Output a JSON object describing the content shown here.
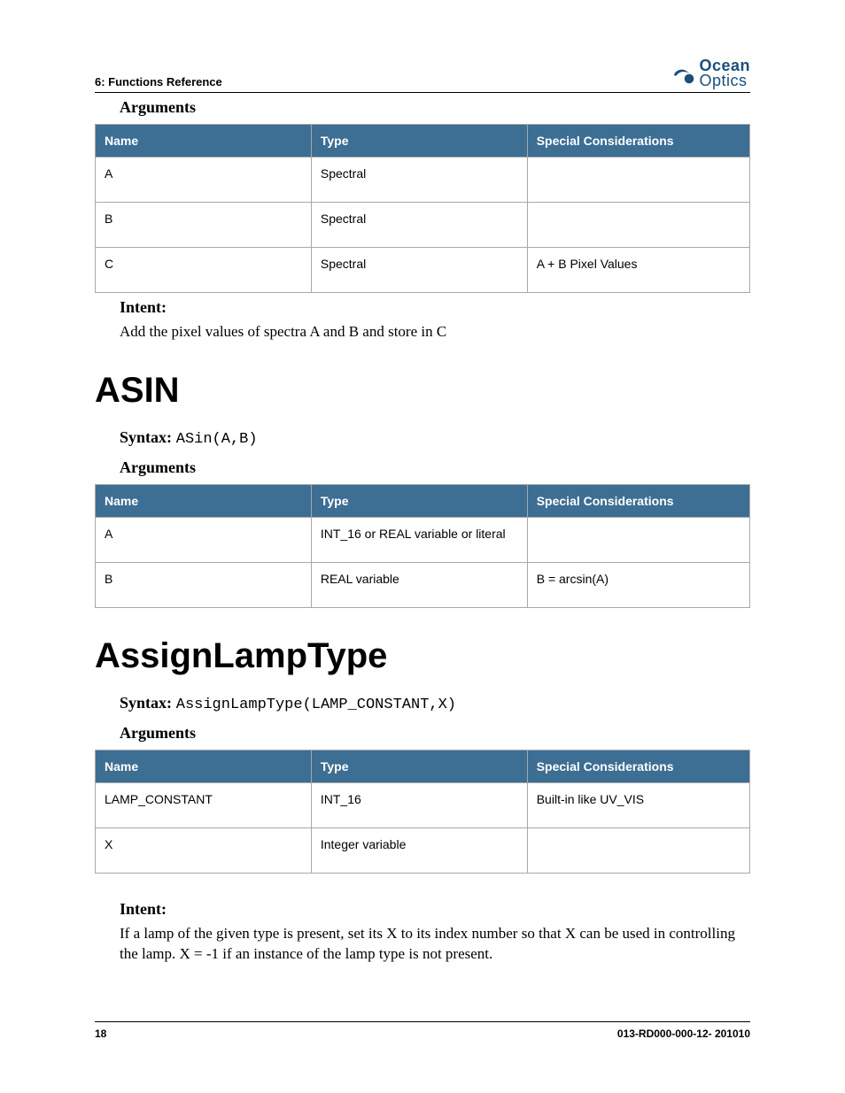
{
  "header": {
    "chapter": "6: Functions Reference",
    "logo_top": "Ocean",
    "logo_bottom": "Optics"
  },
  "labels": {
    "arguments": "Arguments",
    "intent": "Intent:",
    "syntax": "Syntax:",
    "col_name": "Name",
    "col_type": "Type",
    "col_spec": "Special Considerations"
  },
  "section1": {
    "args": [
      {
        "name": "A",
        "type": "Spectral",
        "spec": ""
      },
      {
        "name": "B",
        "type": "Spectral",
        "spec": ""
      },
      {
        "name": "C",
        "type": "Spectral",
        "spec": "A + B Pixel Values"
      }
    ],
    "intent_text": "Add the pixel values of spectra A and B and store in C"
  },
  "section2": {
    "title": "ASIN",
    "syntax_code": "ASin(A,B)",
    "args": [
      {
        "name": "A",
        "type": "INT_16 or REAL variable or literal",
        "spec": ""
      },
      {
        "name": "B",
        "type": "REAL variable",
        "spec": "B = arcsin(A)"
      }
    ]
  },
  "section3": {
    "title": "AssignLampType",
    "syntax_code": "AssignLampType(LAMP_CONSTANT,X)",
    "args": [
      {
        "name": "LAMP_CONSTANT",
        "type": "INT_16",
        "spec": "Built-in like UV_VIS"
      },
      {
        "name": "X",
        "type": "Integer variable",
        "spec": ""
      }
    ],
    "intent_text": "If a lamp of the given type is present, set its X to its index number so that X can be used in controlling the lamp. X = -1 if an instance of the lamp type is not present."
  },
  "footer": {
    "page_num": "18",
    "doc_id": "013-RD000-000-12- 201010"
  }
}
